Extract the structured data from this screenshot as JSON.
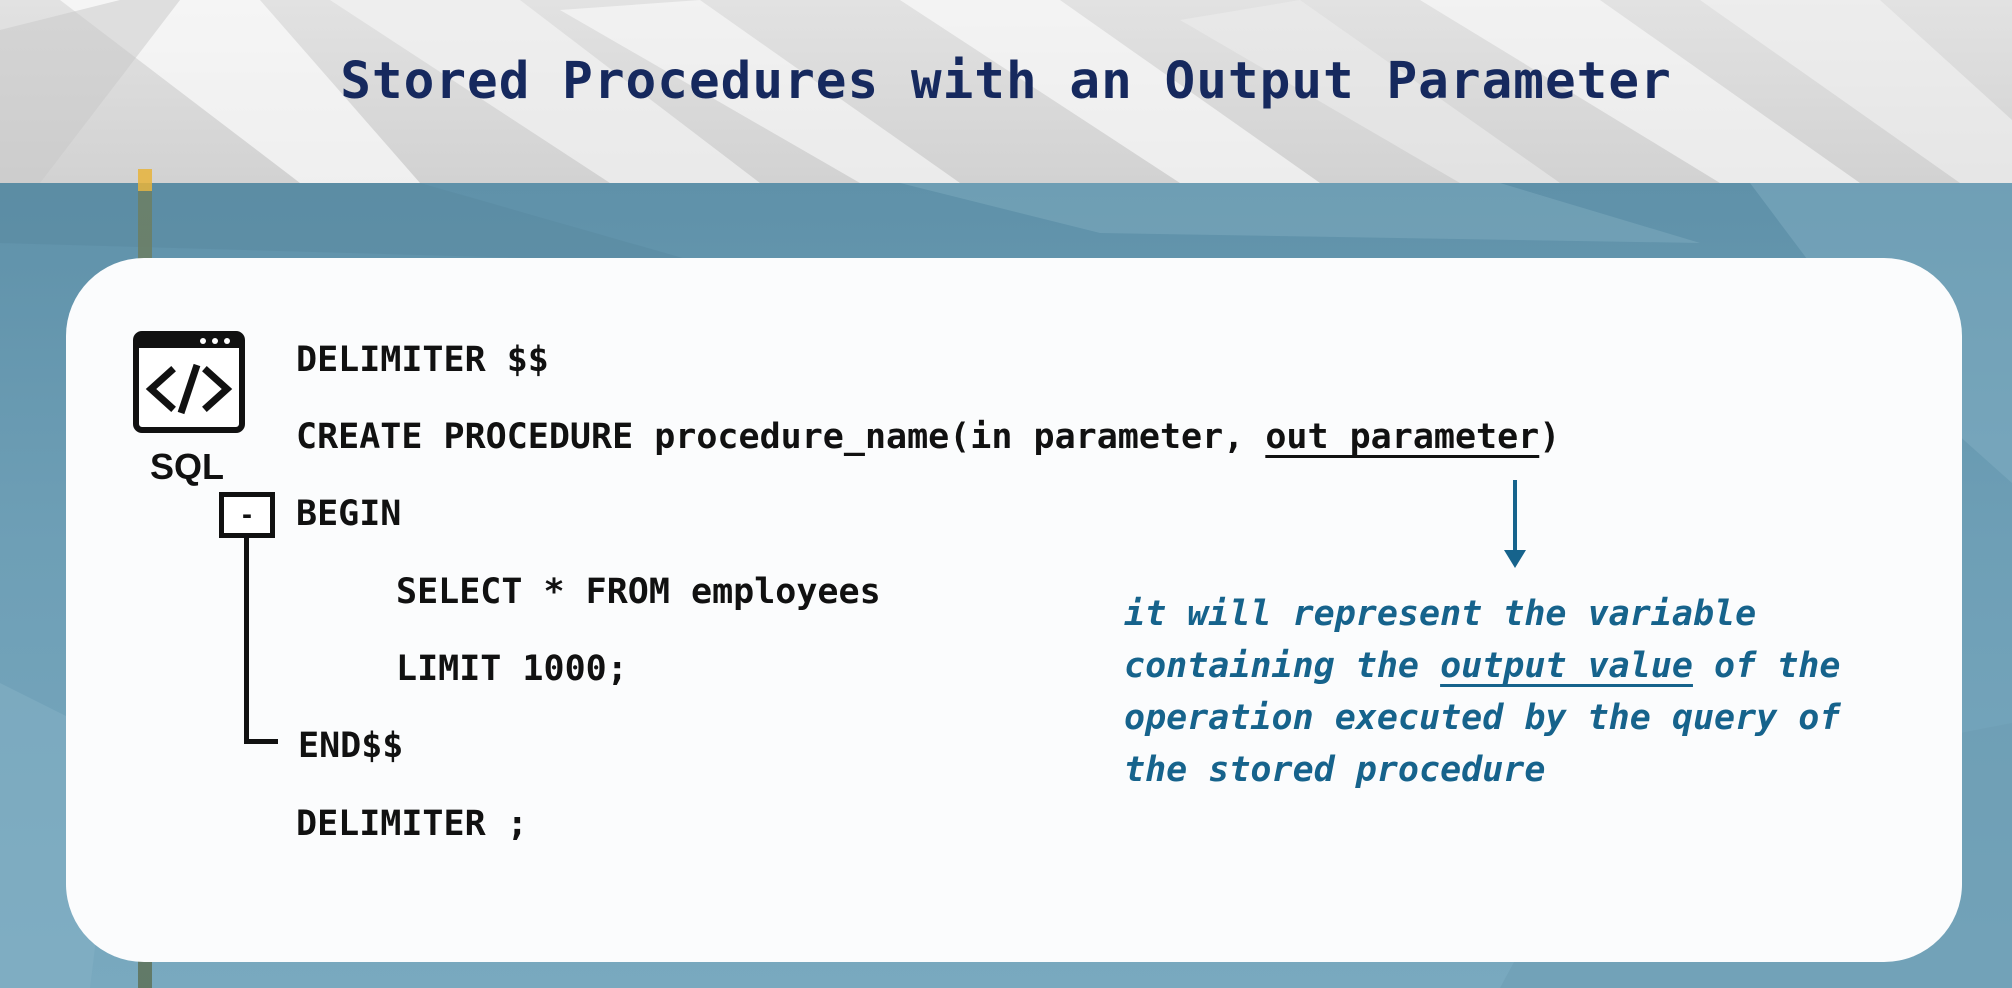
{
  "slide": {
    "title": "Stored Procedures with an Output Parameter"
  },
  "icon": {
    "name": "code-window-icon",
    "label": "SQL"
  },
  "tree": {
    "collapse_symbol": "-"
  },
  "code": {
    "line1": "DELIMITER $$",
    "line2_prefix": "CREATE PROCEDURE procedure_name(in parameter, ",
    "line2_highlight": "out parameter",
    "line2_suffix": ")",
    "line3": "BEGIN",
    "line4": "SELECT * FROM employees",
    "line5": "LIMIT 1000;",
    "line6": "END$$",
    "line7": "DELIMITER ;"
  },
  "note": {
    "part1": "it will represent the variable containing the ",
    "highlight": "output value",
    "part2": " of the operation executed by the query of the stored procedure"
  },
  "colors": {
    "title": "#16295e",
    "note": "#16638c",
    "arrow": "#16638c",
    "card": "#fbfcfd",
    "background_blue": "#6596ad"
  }
}
